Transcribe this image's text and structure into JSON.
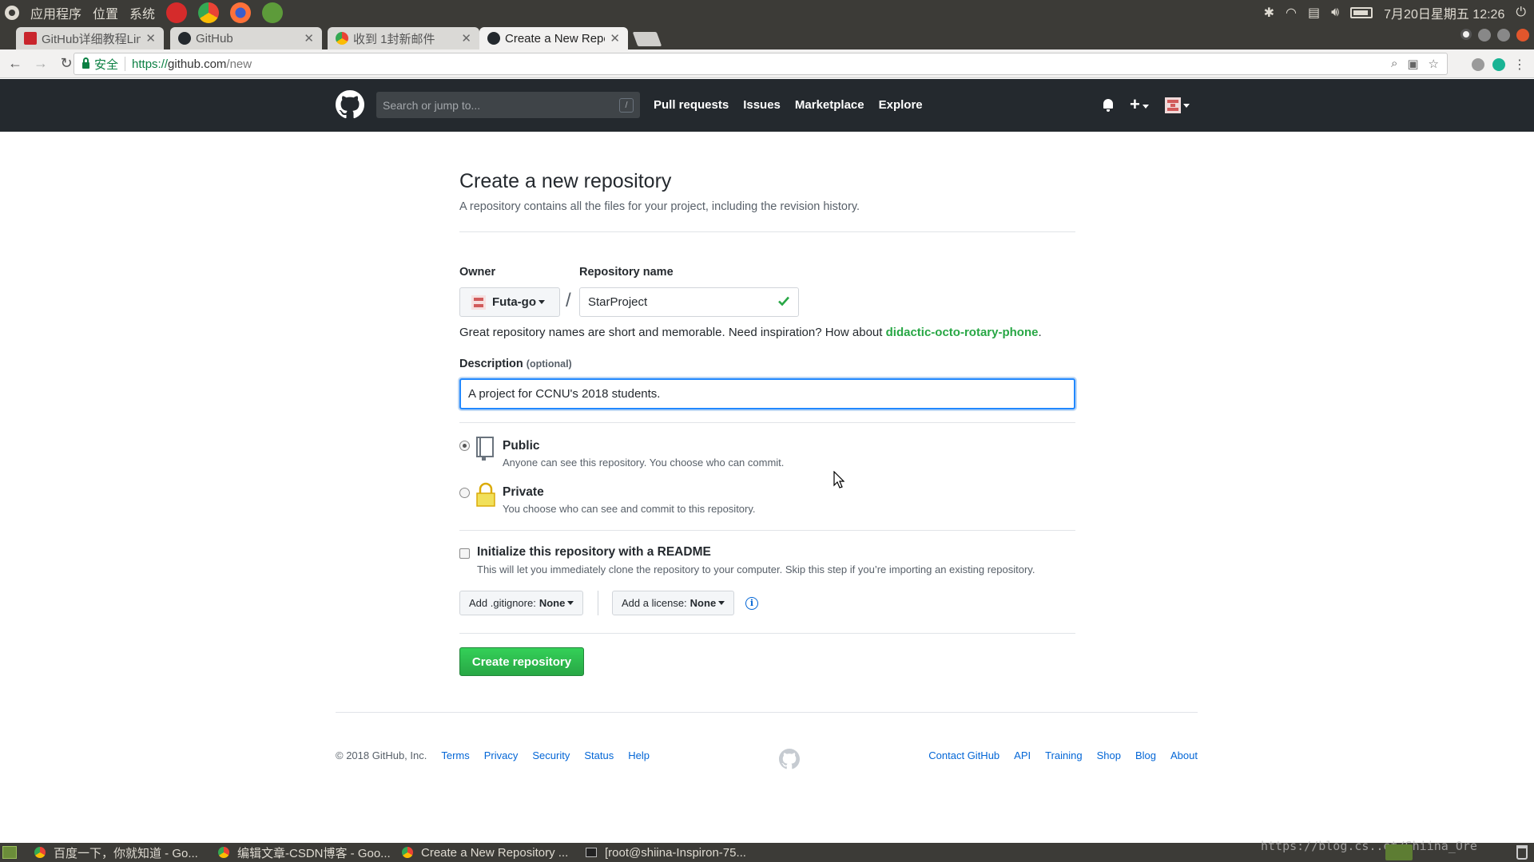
{
  "os_panel": {
    "menus": [
      "应用程序",
      "位置",
      "系统"
    ],
    "clock": "7月20日星期五 12:26",
    "launcher_colors": [
      "#d52b2b",
      "#4285f4",
      "#ff7139",
      "#5d9b3a"
    ]
  },
  "browser": {
    "tabs": [
      {
        "title": "GitHub详细教程Lin",
        "favicon_color": "#c9252c",
        "active": false
      },
      {
        "title": "GitHub",
        "favicon_color": "#24292e",
        "active": false
      },
      {
        "title": "收到 1封新邮件",
        "favicon_color": "#4285f4",
        "active": false
      },
      {
        "title": "Create a New Repo",
        "favicon_color": "#24292e",
        "active": true
      }
    ],
    "secure_label": "安全",
    "url": {
      "scheme": "https://",
      "host": "github.com",
      "path": "/new"
    }
  },
  "github_header": {
    "search_placeholder": "Search or jump to...",
    "search_shortcut": "/",
    "nav": [
      "Pull requests",
      "Issues",
      "Marketplace",
      "Explore"
    ]
  },
  "form": {
    "title": "Create a new repository",
    "subtitle": "A repository contains all the files for your project, including the revision history.",
    "owner_label": "Owner",
    "owner_value": "Futa-go",
    "slash": "/",
    "repo_name_label": "Repository name",
    "repo_name_value": "StarProject",
    "hint_prefix": "Great repository names are short and memorable. Need inspiration? How about ",
    "hint_suggestion": "didactic-octo-rotary-phone",
    "hint_suffix": ".",
    "description_label": "Description",
    "description_optional": "(optional)",
    "description_value": "A project for CCNU's 2018 students.",
    "visibility": [
      {
        "title": "Public",
        "note": "Anyone can see this repository. You choose who can commit.",
        "selected": true
      },
      {
        "title": "Private",
        "note": "You choose who can see and commit to this repository.",
        "selected": false
      }
    ],
    "readme_title": "Initialize this repository with a README",
    "readme_note": "This will let you immediately clone the repository to your computer. Skip this step if you’re importing an existing repository.",
    "readme_checked": false,
    "gitignore_label": "Add .gitignore:",
    "gitignore_value": "None",
    "license_label": "Add a license:",
    "license_value": "None",
    "info_glyph": "i",
    "submit_label": "Create repository"
  },
  "footer": {
    "copyright": "© 2018 GitHub, Inc.",
    "left_links": [
      "Terms",
      "Privacy",
      "Security",
      "Status",
      "Help"
    ],
    "right_links": [
      "Contact GitHub",
      "API",
      "Training",
      "Shop",
      "Blog",
      "About"
    ]
  },
  "taskbar": {
    "items": [
      {
        "title": "百度一下，你就知道 - Go...",
        "icon": "chrome-icon"
      },
      {
        "title": "编辑文章-CSDN博客 - Goo...",
        "icon": "chrome-icon"
      },
      {
        "title": "Create a New Repository ...",
        "icon": "chrome-icon"
      },
      {
        "title": "[root@shiina-Inspiron-75...",
        "icon": "terminal-icon"
      }
    ],
    "watermark": "https://blog.cs..et/Shiina_Ore"
  },
  "colors": {
    "github_header": "#24292e",
    "link": "#0366d6",
    "success": "#28a745",
    "os_panel": "#3c3b37"
  }
}
